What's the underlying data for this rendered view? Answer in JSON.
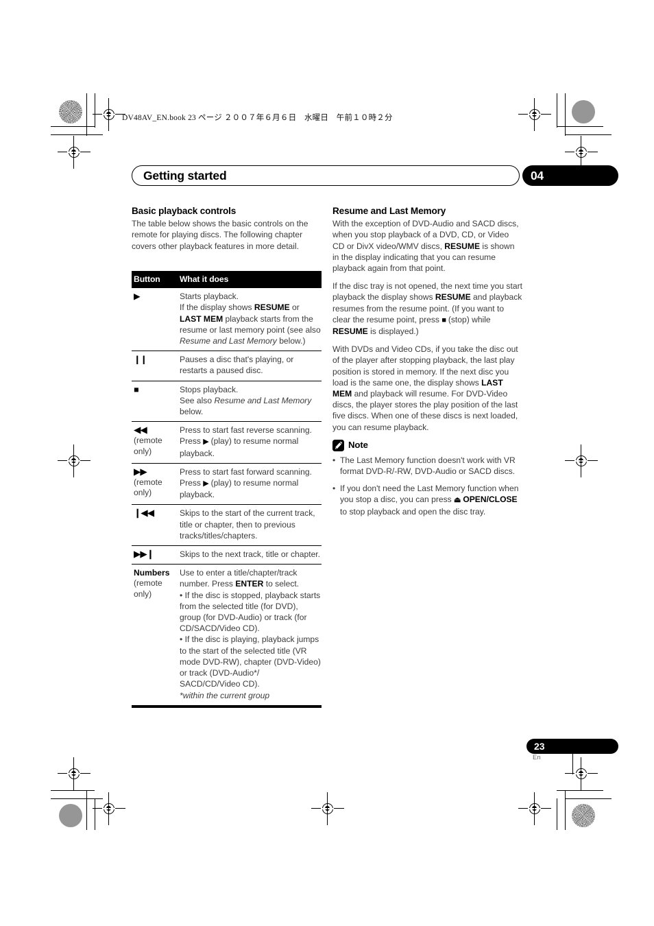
{
  "print_header": {
    "text": "DV48AV_EN.book   23 ページ   ２００７年６月６日　水曜日　午前１０時２分"
  },
  "chapter_bar": {
    "title": "Getting started",
    "number": "04"
  },
  "left_column": {
    "heading": "Basic playback controls",
    "intro": "The table below shows the basic controls on the remote for playing discs. The following chapter covers other playback features in more detail.",
    "table": {
      "headers": [
        "Button",
        "What it does"
      ],
      "rows": [
        {
          "button_glyph": "▶",
          "button_label": "",
          "button_note": "",
          "lines": [
            "Starts playback.",
            "If the display shows RESUME or LAST MEM playback starts from the resume or last memory point (see also Resume and Last Memory below.)"
          ]
        },
        {
          "button_glyph": "❙❙",
          "button_label": "",
          "button_note": "",
          "lines": [
            "Pauses a disc that's playing, or restarts a paused disc."
          ]
        },
        {
          "button_glyph": "■",
          "button_label": "",
          "button_note": "",
          "lines": [
            "Stops playback.",
            "See also Resume and Last Memory below."
          ]
        },
        {
          "button_glyph": "◀◀",
          "button_label": "",
          "button_note": "(remote only)",
          "lines": [
            "Press to start fast reverse scanning. Press ▶ (play) to resume normal playback."
          ]
        },
        {
          "button_glyph": "▶▶",
          "button_label": "",
          "button_note": "(remote only)",
          "lines": [
            "Press to start fast forward scanning. Press ▶ (play) to resume normal playback."
          ]
        },
        {
          "button_glyph": "❙◀◀",
          "button_label": "",
          "button_note": "",
          "lines": [
            "Skips to the start of the current track, title or chapter, then to previous tracks/titles/chapters."
          ]
        },
        {
          "button_glyph": "▶▶❙",
          "button_label": "",
          "button_note": "",
          "lines": [
            "Skips to the next track, title or chapter."
          ]
        },
        {
          "button_glyph": "",
          "button_label": "Numbers",
          "button_note": "(remote only)",
          "lines": [
            "Use to enter a title/chapter/track number. Press ENTER to select.",
            "• If the disc is stopped, playback starts from the selected title (for DVD), group (for DVD-Audio) or track (for CD/SACD/Video CD).",
            "• If the disc is playing, playback jumps to the start of the selected title (VR mode DVD-RW), chapter (DVD-Video) or track (DVD-Audio*/SACD/CD/Video CD).",
            "*within the current group"
          ]
        }
      ]
    }
  },
  "right_column": {
    "heading": "Resume and Last Memory",
    "paragraphs": [
      "With the exception of DVD-Audio and SACD discs, when you stop playback of a DVD, CD, or Video CD or DivX video/WMV discs, RESUME is shown in the display indicating that you can resume playback again from that point.",
      "If the disc tray is not opened, the next time you start playback the display shows RESUME and playback resumes from the resume point. (If you want to clear the resume point, press ■ (stop) while RESUME is displayed.)",
      "With DVDs and Video CDs, if you take the disc out of the player after stopping playback, the last play position is stored in memory. If the next disc you load is the same one, the display shows LAST MEM and playback will resume. For DVD-Video discs, the player stores the play position of the last five discs. When one of these discs is next loaded, you can resume playback."
    ],
    "note": {
      "icon": "pencil-note-icon",
      "title": "Note",
      "items": [
        "The Last Memory function doesn't work with VR format DVD-R/-RW, DVD-Audio or SACD discs.",
        "If you don't need the Last Memory function when you stop a disc, you can press ⏏ OPEN/CLOSE to stop playback and open the disc tray."
      ]
    }
  },
  "footer": {
    "page_number": "23",
    "language": "En"
  },
  "colors": {
    "ink": "#000000",
    "body_text": "#3b3b3b",
    "paper": "#ffffff"
  }
}
